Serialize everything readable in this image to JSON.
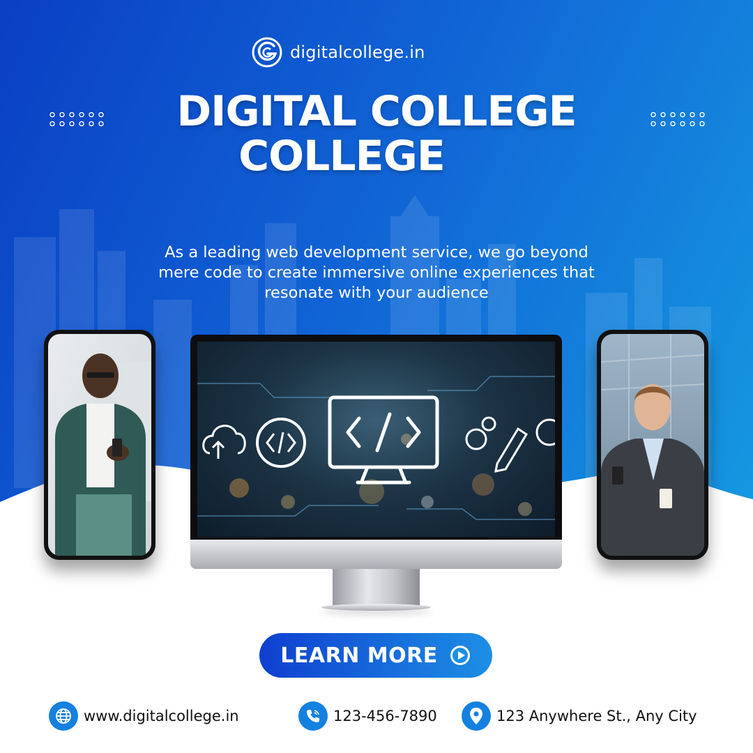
{
  "brand": {
    "name": "digitalcollege.in",
    "logo_icon": "logo-g-icon"
  },
  "headline": {
    "line1": "DIGITAL COLLEGE",
    "line2": "COLLEGE"
  },
  "description": {
    "line1": "As a leading web development service, we go beyond",
    "line2": "mere code to create immersive online experiences that",
    "line3": "resonate with your audience"
  },
  "cta": {
    "label": "LEARN MORE",
    "icon": "play-circle-icon"
  },
  "contacts": [
    {
      "icon": "globe-icon",
      "text": "www.digitalcollege.in"
    },
    {
      "icon": "phone-icon",
      "text": "123-456-7890"
    },
    {
      "icon": "location-pin-icon",
      "text": "123 Anywhere St., Any City"
    }
  ],
  "colors": {
    "accent": "#1481e0",
    "bg_start": "#0a3fc4",
    "bg_end": "#16a3e3",
    "text_light": "#ffffff",
    "text_dark": "#111111"
  }
}
